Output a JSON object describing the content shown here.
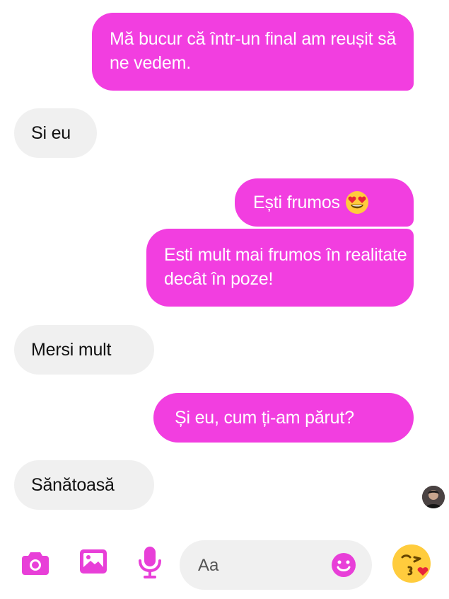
{
  "messages": [
    {
      "dir": "out",
      "text": "Mă bucur că într-un final am reușit să ne vedem."
    },
    {
      "dir": "in",
      "text": "Si eu"
    },
    {
      "dir": "out",
      "text": "Ești frumos",
      "emoji": "heart-eyes-emoji"
    },
    {
      "dir": "out",
      "text": "Esti mult mai frumos în realitate decât în poze!"
    },
    {
      "dir": "in",
      "text": "Mersi mult"
    },
    {
      "dir": "out",
      "text": "Și eu, cum ți-am părut?"
    },
    {
      "dir": "in",
      "text": "Sănătoasă"
    }
  ],
  "composer": {
    "placeholder": "Aa",
    "tools": [
      "camera-icon",
      "image-icon",
      "microphone-icon",
      "smiley-icon"
    ],
    "quick_reaction": "kissing-heart-emoji"
  },
  "colors": {
    "outgoing_bubble": "#f23ee0",
    "incoming_bubble": "#f0f0f0",
    "accent": "#e83fd8"
  }
}
